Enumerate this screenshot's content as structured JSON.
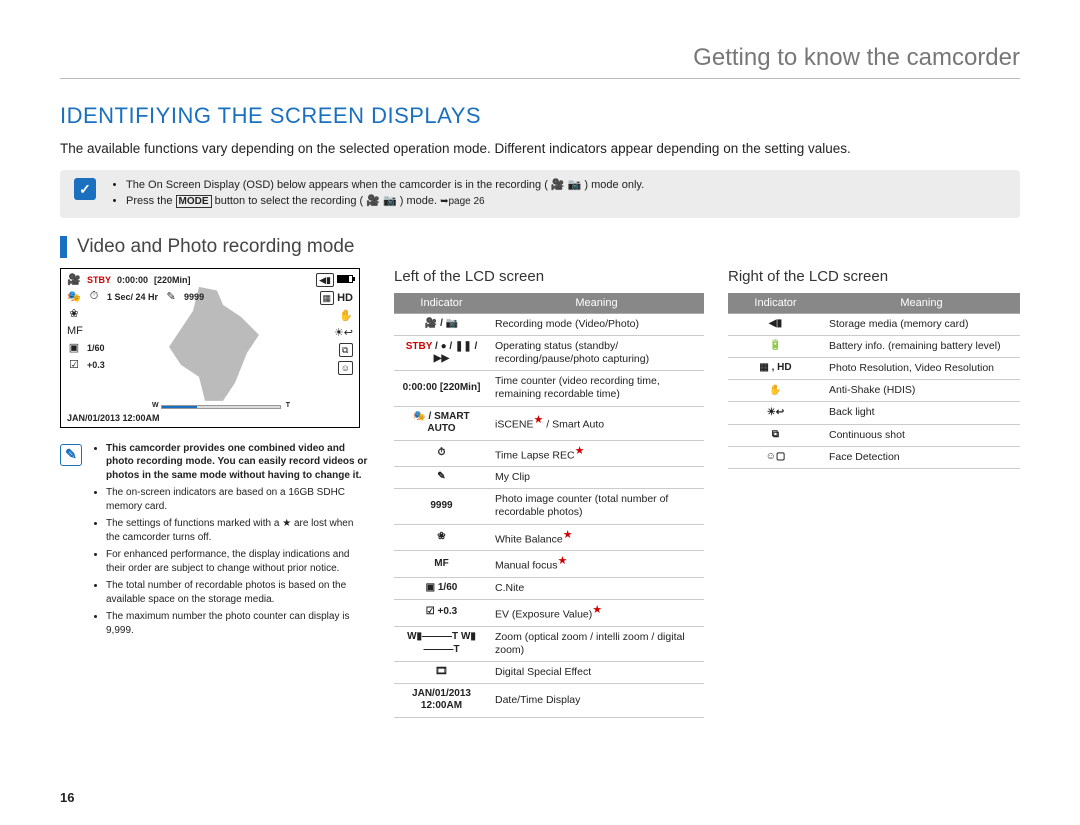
{
  "chapter": "Getting to know the camcorder",
  "title": "IDENTIFIYING THE SCREEN DISPLAYS",
  "intro": "The available functions vary depending on the selected operation mode. Different indicators appear depending on the setting values.",
  "page_number": "16",
  "top_note": {
    "items": [
      "The On Screen Display (OSD) below appears when the camcorder is in the recording ( 🎥 📷 ) mode only.",
      "Press the [MODE] button to select the recording ( 🎥 📷 ) mode. ➥page 26"
    ]
  },
  "section_heading": "Video and Photo recording mode",
  "lcd": {
    "stby": "STBY",
    "counter": "0:00:00",
    "remain": "[220Min]",
    "interval": "1 Sec/ 24 Hr",
    "photo_count": "9999",
    "cnite": "1/60",
    "ev": "+0.3",
    "datetime": "JAN/01/2013 12:00AM",
    "hd": "HD"
  },
  "left_notes": [
    {
      "bold": true,
      "text": "This camcorder provides one combined video and photo recording mode. You can easily record videos or photos in the same mode without having to change it."
    },
    {
      "bold": false,
      "text": "The on-screen indicators are based on a 16GB SDHC memory card."
    },
    {
      "bold": false,
      "text": "The settings of functions marked with a ★ are lost when the camcorder turns off."
    },
    {
      "bold": false,
      "text": "For enhanced performance, the display indications and their order are subject to change without prior notice."
    },
    {
      "bold": false,
      "text": "The total number of recordable photos is based on the available space on the storage media."
    },
    {
      "bold": false,
      "text": "The maximum number the photo counter can display is 9,999."
    }
  ],
  "left_table": {
    "heading": "Left of the LCD screen",
    "th_indicator": "Indicator",
    "th_meaning": "Meaning",
    "rows": [
      {
        "ind": "🎥 / 📷",
        "meaning": "Recording mode (Video/Photo)"
      },
      {
        "ind": "STBY / ● / ❚❚ / ▶▶",
        "stby_color": true,
        "meaning": "Operating status (standby/ recording/pause/photo capturing)"
      },
      {
        "ind": "0:00:00 [220Min]",
        "meaning": "Time counter (video recording time, remaining recordable time)"
      },
      {
        "ind": "🎭 / SMART AUTO",
        "meaning": "iSCENE★ / Smart Auto",
        "star": true
      },
      {
        "ind": "⏱",
        "meaning": "Time Lapse REC★",
        "star": true
      },
      {
        "ind": "✎",
        "meaning": "My Clip"
      },
      {
        "ind": "9999",
        "meaning": "Photo image counter (total number of recordable photos)"
      },
      {
        "ind": "❀",
        "meaning": "White Balance★",
        "star": true
      },
      {
        "ind": "MF",
        "meaning": "Manual focus★",
        "star": true
      },
      {
        "ind": "▣ 1/60",
        "meaning": "C.Nite"
      },
      {
        "ind": "☑ +0.3",
        "meaning": "EV (Exposure Value)★",
        "star": true
      },
      {
        "ind": "W▮———T\nW▮———T",
        "meaning": "Zoom (optical zoom / intelli zoom / digital zoom)"
      },
      {
        "ind": "🎞",
        "meaning": "Digital Special Effect"
      },
      {
        "ind": "JAN/01/2013 12:00AM",
        "meaning": "Date/Time Display"
      }
    ]
  },
  "right_table": {
    "heading": "Right of the LCD screen",
    "th_indicator": "Indicator",
    "th_meaning": "Meaning",
    "rows": [
      {
        "ind": "◀▮",
        "meaning": "Storage media (memory card)"
      },
      {
        "ind": "🔋",
        "meaning": "Battery info. (remaining battery level)"
      },
      {
        "ind": "▦ , HD",
        "meaning": "Photo Resolution, Video Resolution"
      },
      {
        "ind": "✋",
        "meaning": "Anti-Shake (HDIS)"
      },
      {
        "ind": "☀↩",
        "meaning": "Back light"
      },
      {
        "ind": "⧉",
        "meaning": "Continuous shot"
      },
      {
        "ind": "☺▢",
        "meaning": "Face Detection"
      }
    ]
  }
}
